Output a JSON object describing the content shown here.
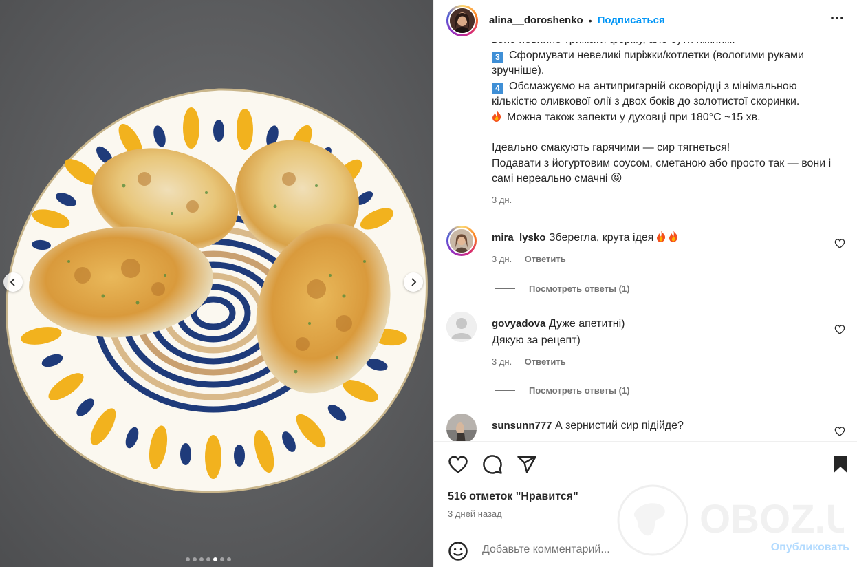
{
  "post": {
    "author": "alina__doroshenko",
    "separator": "•",
    "follow_label": "Подписаться"
  },
  "caption": {
    "line_top": "воно повинно тримати форму, але бути ніжним.",
    "step3_badge": "3",
    "step3": "Сформувати невеликі пиріжки/котлетки (вологими руками зручніше).",
    "step4_badge": "4",
    "step4": "Обсмажуємо на антипригарній сковорідці з мінімальною кількістю оливкової олії з двох боків до золотистої скоринки.",
    "tip": "Можна також запекти у духовці при 180°C ~15 хв.",
    "closing1": "Ідеально смакують гарячими — сир тягнеться!",
    "closing2": "Подавати з йогуртовим соусом, сметаною або просто так — вони і самі нереально смачні 😝",
    "time": "3 дн."
  },
  "comments": [
    {
      "user": "mira_lysko",
      "text": "Зберегла, крута ідея",
      "time": "3 дн.",
      "reply": "Ответить",
      "view_replies": "Посмотреть ответы (1)"
    },
    {
      "user": "govyadova",
      "text": "Дуже апетитні)",
      "text2": "Дякую за рецепт)",
      "time": "3 дн.",
      "reply": "Ответить",
      "view_replies": "Посмотреть ответы (1)"
    },
    {
      "user": "sunsunn777",
      "text": "А зернистий сир підійде?"
    }
  ],
  "stats": {
    "likes": "516 отметок \"Нравится\"",
    "date": "3 дней назад"
  },
  "comment_box": {
    "placeholder": "Добавьте комментарий...",
    "publish_label": "Опубликовать"
  },
  "watermark": {
    "text": "OBOZ.UA"
  },
  "carousel": {
    "count": 7,
    "active": 4
  },
  "colors": {
    "accent": "#0095f6",
    "publish_disabled": "#b3dbff",
    "secondary_text": "#737373"
  }
}
